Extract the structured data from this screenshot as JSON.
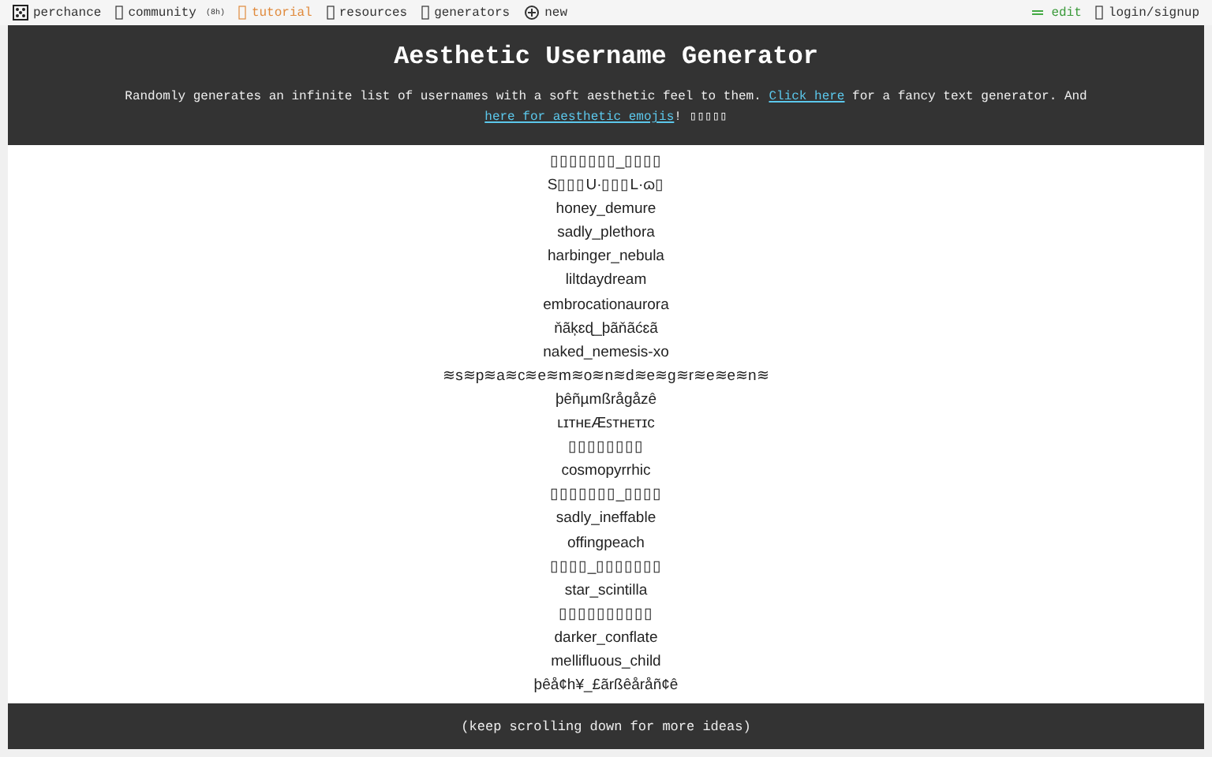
{
  "nav": {
    "left": [
      {
        "label": "perchance",
        "kind": "plain"
      },
      {
        "label": "community",
        "note": "(8h)",
        "kind": "plain"
      },
      {
        "label": "tutorial",
        "kind": "accent"
      },
      {
        "label": "resources",
        "kind": "plain"
      },
      {
        "label": "generators",
        "kind": "plain"
      },
      {
        "label": "new",
        "kind": "plain"
      }
    ],
    "right": [
      {
        "label": "edit",
        "kind": "green"
      },
      {
        "label": "login/signup",
        "kind": "plain"
      }
    ]
  },
  "header": {
    "title": "Aesthetic Username Generator",
    "description": [
      {
        "kind": "text",
        "text": "Randomly generates an infinite list of usernames with a soft aesthetic feel to them. "
      },
      {
        "kind": "link",
        "text": "Click here"
      },
      {
        "kind": "text",
        "text": " for a fancy text generator. And "
      },
      {
        "kind": "link",
        "text": "here for aesthetic emojis"
      },
      {
        "kind": "text",
        "text": "! ▯▯▯▯▯"
      }
    ]
  },
  "usernames": [
    "▯▯▯▯▯▯▯_▯▯▯▯",
    "S▯▯▯U·▯▯▯L·ɷ▯",
    "honey_demure",
    "sadly_plethora",
    "harbinger_nebula",
    "liltdaydream",
    "embrocationaurora",
    "ňãķɛɖ_þãňãćɛã",
    "naked_nemesis-xo",
    "≋s≋p≋a≋c≋e≋m≋o≋n≋d≋e≋g≋r≋e≋e≋n≋",
    "þêñµmßrågåzê",
    "ʟɪᴛʜᴇÆꜱᴛʜᴇᴛɪᴄ",
    "▯▯▯▯▯▯▯▯",
    "cosmopyrrhic",
    "▯▯▯▯▯▯▯_▯▯▯▯",
    "sadly_ineffable",
    "offingpeach",
    "▯▯▯▯_▯▯▯▯▯▯▯",
    "star_scintilla",
    "▯▯▯▯▯▯▯▯▯▯",
    "darker_conflate",
    "mellifluous_child",
    "þêå¢h¥_£ãrßêåråñ¢ê"
  ],
  "footer": "(keep scrolling down for more ideas)"
}
